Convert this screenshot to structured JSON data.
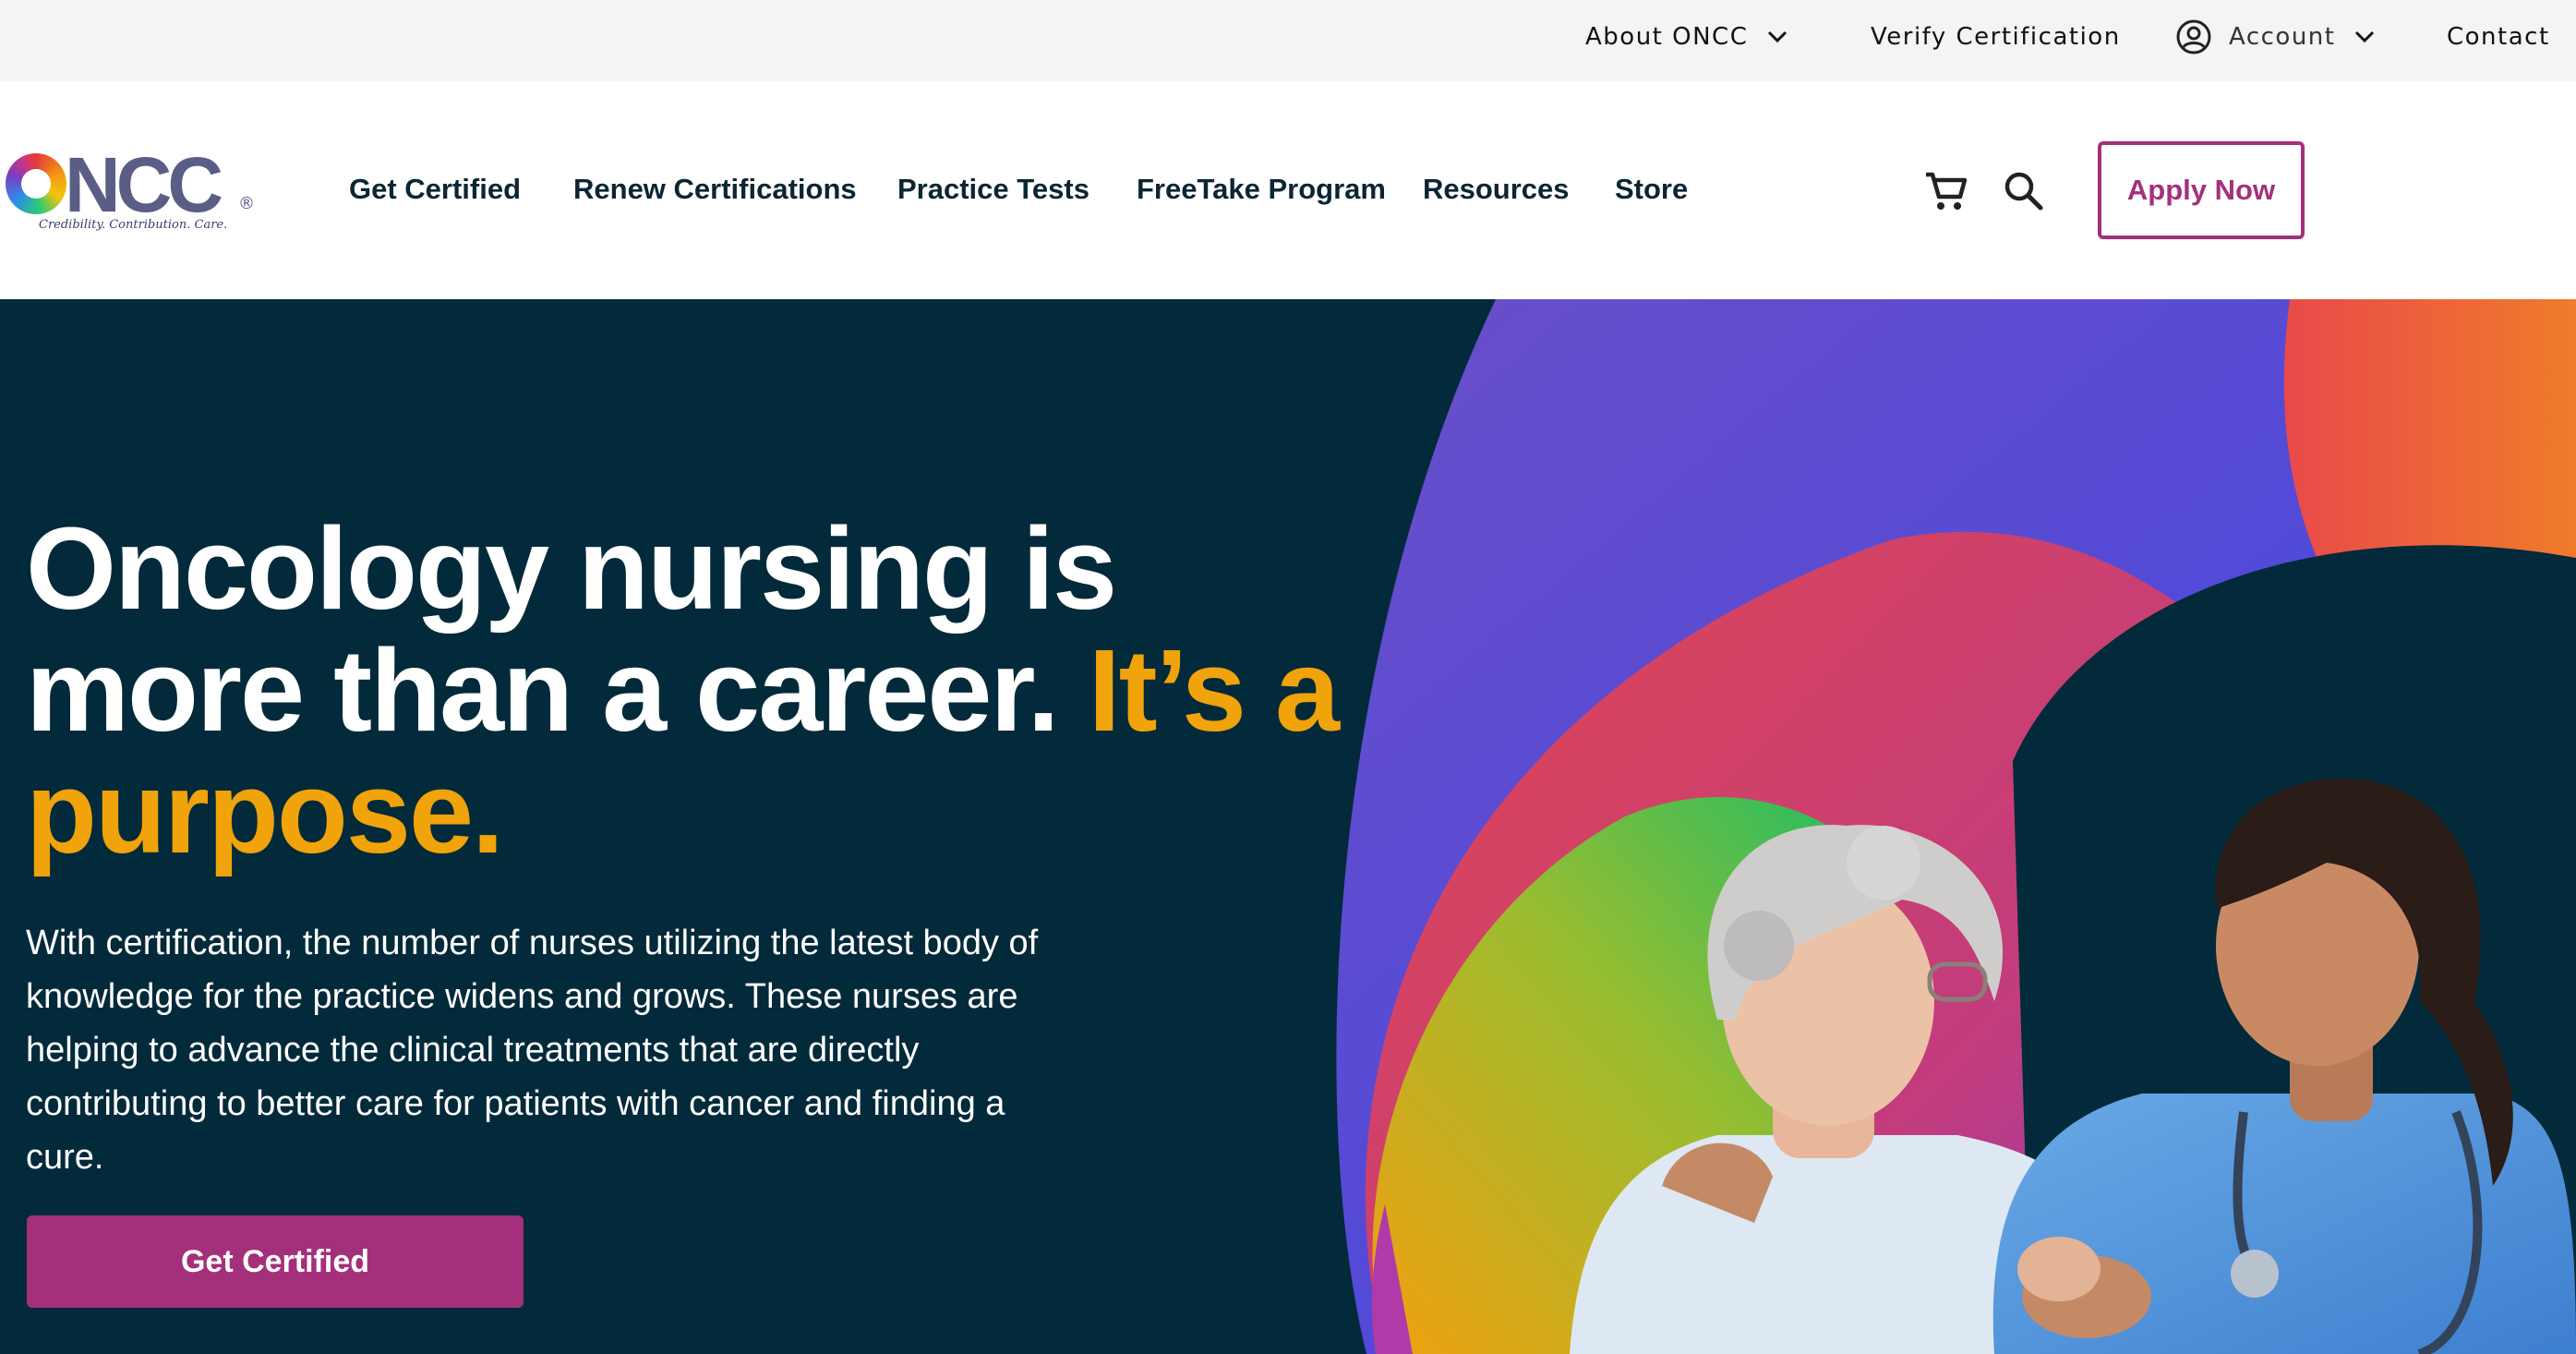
{
  "utility_nav": {
    "about_label": "About ONCC",
    "verify_label": "Verify Certification",
    "account_label": "Account",
    "contact_label": "Contact"
  },
  "logo": {
    "wordmark": "ONCC",
    "registered": "®",
    "tagline": "Credibility. Contribution. Care."
  },
  "main_nav": {
    "items": [
      {
        "label": "Get Certified"
      },
      {
        "label": "Renew Certifications"
      },
      {
        "label": "Practice Tests"
      },
      {
        "label": "FreeTake Program"
      },
      {
        "label": "Resources"
      },
      {
        "label": "Store"
      }
    ],
    "cart_icon": "shopping-cart-icon",
    "search_icon": "magnifier-icon",
    "apply_label": "Apply Now"
  },
  "hero": {
    "title_main": "Oncology nursing is more than a career.",
    "title_accent": "It’s a purpose.",
    "body": "With certification, the number of nurses utilizing the latest body of knowledge for the practice widens and grows. These nurses are helping to advance the clinical treatments that are directly contributing to better care for patients with cancer and finding a cure.",
    "cta_label": "Get Certified"
  },
  "colors": {
    "brand_plum": "#a4307b",
    "hero_bg": "#032a3a",
    "accent_gold": "#f0a30a",
    "utility_bg": "#f3f4f3"
  }
}
